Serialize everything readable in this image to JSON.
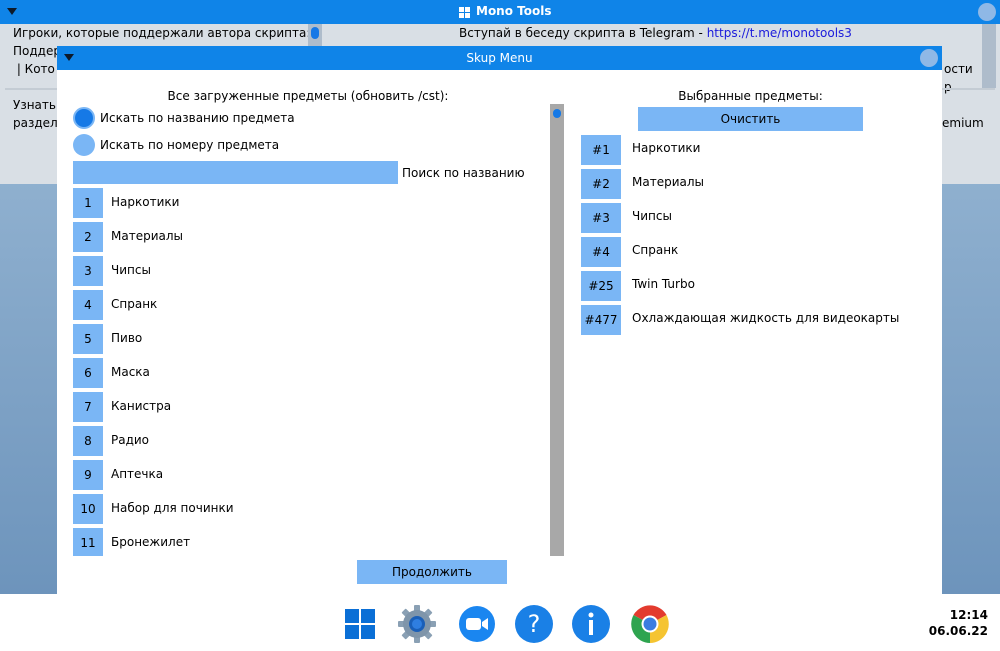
{
  "mono_tools": {
    "title": "Mono Tools",
    "left_lines": [
      "Игроки, которые поддержали автора скрипта:",
      "Поддер",
      " | Кото",
      "Узнать ",
      "разделе"
    ],
    "right_line": "Вступай в беседу скрипта в Telegram - ",
    "right_link": "https://t.me/monotools3",
    "right_fragments": [
      "ости",
      "р",
      "emium"
    ]
  },
  "skup_menu": {
    "title": "Skup Menu",
    "left_header": "Все загруженные предметы (обновить /cst):",
    "radio_by_name": "Искать по названию предмета",
    "radio_by_number": "Искать по номеру предмета",
    "search_value": "",
    "search_label": "Поиск по названию",
    "items": [
      {
        "num": "1",
        "name": "Наркотики"
      },
      {
        "num": "2",
        "name": "Материалы"
      },
      {
        "num": "3",
        "name": "Чипсы"
      },
      {
        "num": "4",
        "name": "Спранк"
      },
      {
        "num": "5",
        "name": "Пиво"
      },
      {
        "num": "6",
        "name": "Маска"
      },
      {
        "num": "7",
        "name": "Канистра"
      },
      {
        "num": "8",
        "name": "Радио"
      },
      {
        "num": "9",
        "name": "Аптечка"
      },
      {
        "num": "10",
        "name": "Набор для починки"
      },
      {
        "num": "11",
        "name": "Бронежилет"
      }
    ],
    "right_header": "Выбранные предметы:",
    "clear_label": "Очистить",
    "selected": [
      {
        "num": "#1",
        "name": "Наркотики"
      },
      {
        "num": "#2",
        "name": "Материалы"
      },
      {
        "num": "#3",
        "name": "Чипсы"
      },
      {
        "num": "#4",
        "name": "Спранк"
      },
      {
        "num": "#25",
        "name": "Twin Turbo"
      },
      {
        "num": "#477",
        "name": "Охлаждающая жидкость для видеокарты"
      }
    ],
    "continue_label": "Продолжить"
  },
  "taskbar": {
    "icons": [
      "windows-start-icon",
      "settings-gear-icon",
      "zoom-camera-icon",
      "help-question-icon",
      "info-icon",
      "chrome-icon"
    ],
    "time": "12:14",
    "date": "06.06.22"
  },
  "colors": {
    "accent": "#0f84e8",
    "button": "#7ab6f5",
    "radio_selected": "#1679e6"
  }
}
